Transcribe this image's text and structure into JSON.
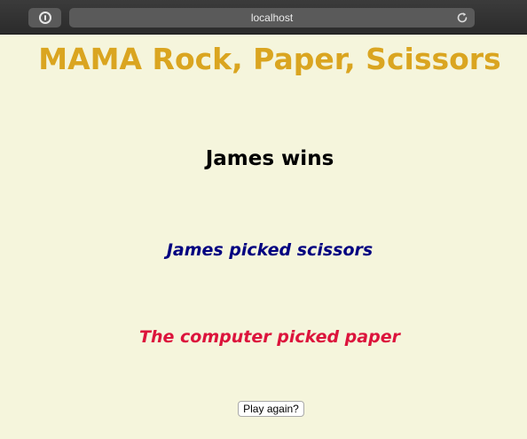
{
  "browser": {
    "url": "localhost",
    "icons": {
      "password": "password-manager-icon",
      "reload": "reload-icon"
    }
  },
  "page": {
    "title": "MAMA Rock, Paper, Scissors",
    "result": "James wins",
    "player_pick": "James picked scissors",
    "computer_pick": "The computer picked paper",
    "play_again_label": "Play again?"
  },
  "colors": {
    "background": "#f5f5dc",
    "title": "#daa520",
    "player_pick": "#000080",
    "computer_pick": "#dc143c"
  }
}
